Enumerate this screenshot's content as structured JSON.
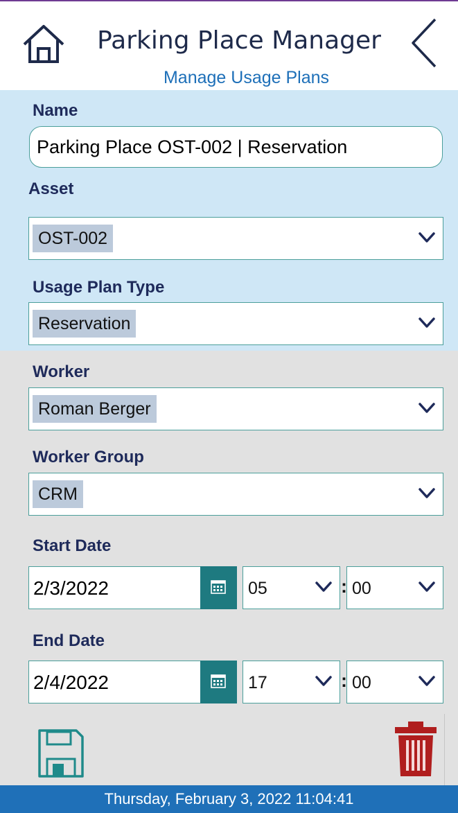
{
  "header": {
    "title": "Parking Place Manager",
    "subtitle": "Manage Usage Plans"
  },
  "form": {
    "name": {
      "label": "Name",
      "value": "Parking Place OST-002 | Reservation"
    },
    "asset": {
      "label": "Asset",
      "value": "OST-002"
    },
    "usage_plan_type": {
      "label": "Usage Plan Type",
      "value": "Reservation"
    },
    "worker": {
      "label": "Worker",
      "value": "Roman Berger"
    },
    "worker_group": {
      "label": "Worker Group",
      "value": "CRM"
    },
    "start_date": {
      "label": "Start Date",
      "date": "2/3/2022",
      "hour": "05",
      "minute": "00"
    },
    "end_date": {
      "label": "End Date",
      "date": "2/4/2022",
      "hour": "17",
      "minute": "00"
    }
  },
  "time_separator": ":",
  "footer": {
    "timestamp": "Thursday, February 3, 2022 11:04:41"
  },
  "icons": {
    "home": "home-icon",
    "back": "chevron-left-icon",
    "dropdown": "chevron-down-icon",
    "calendar": "calendar-icon",
    "save": "floppy-disk-icon",
    "delete": "trash-icon"
  },
  "colors": {
    "title_text": "#1e2a4a",
    "subtitle_text": "#1d6fb8",
    "blue_section": "#cfe7f6",
    "gray_section": "#e1e1e1",
    "field_border": "#4a9e9a",
    "chip_highlight": "#bccadb",
    "calendar_button": "#1e7a80",
    "save_icon": "#1f8a8a",
    "delete_icon": "#b01e1e",
    "footer_bar": "#1f70b8"
  }
}
